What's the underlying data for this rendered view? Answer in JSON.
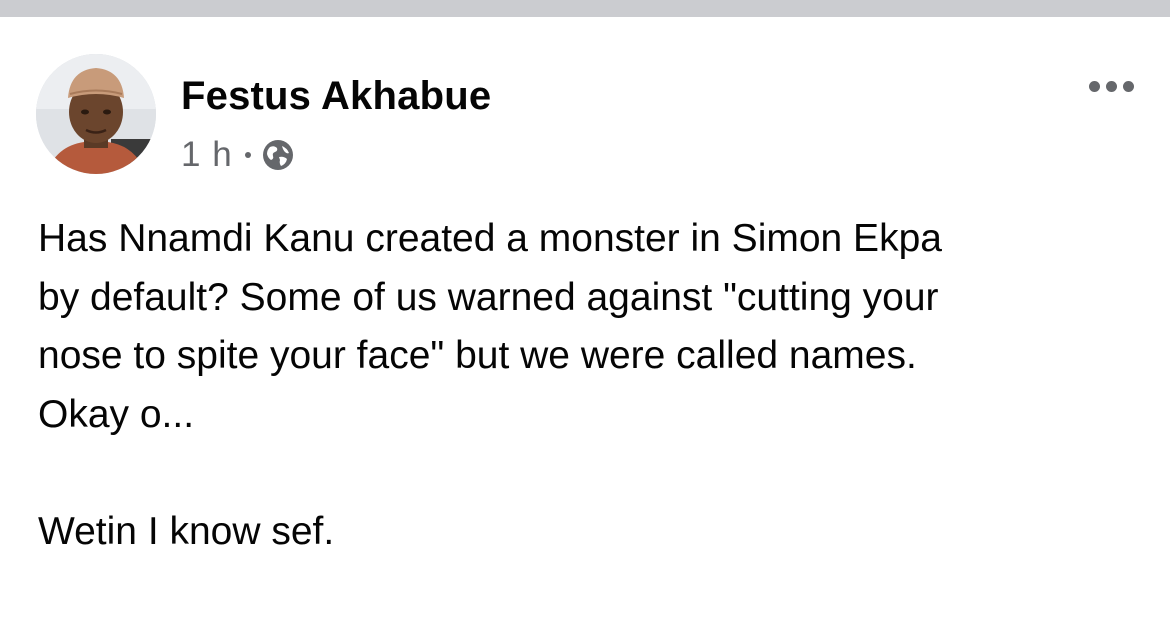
{
  "post": {
    "author": "Festus Akhabue",
    "timestamp": "1 h",
    "separator": "·",
    "audience_icon": "globe-icon",
    "more_icon": "more-options-icon",
    "text": {
      "line1": "Has Nnamdi Kanu created a monster in Simon Ekpa",
      "line2": "by default? Some of us warned against \"cutting your",
      "line3": "nose to spite your face\" but we were called names.",
      "line4": "Okay o...",
      "line5": "Wetin I know sef."
    }
  },
  "colors": {
    "primary_text": "#050505",
    "secondary_text": "#65676b",
    "top_strip": "#cbccd0",
    "background": "#ffffff"
  }
}
